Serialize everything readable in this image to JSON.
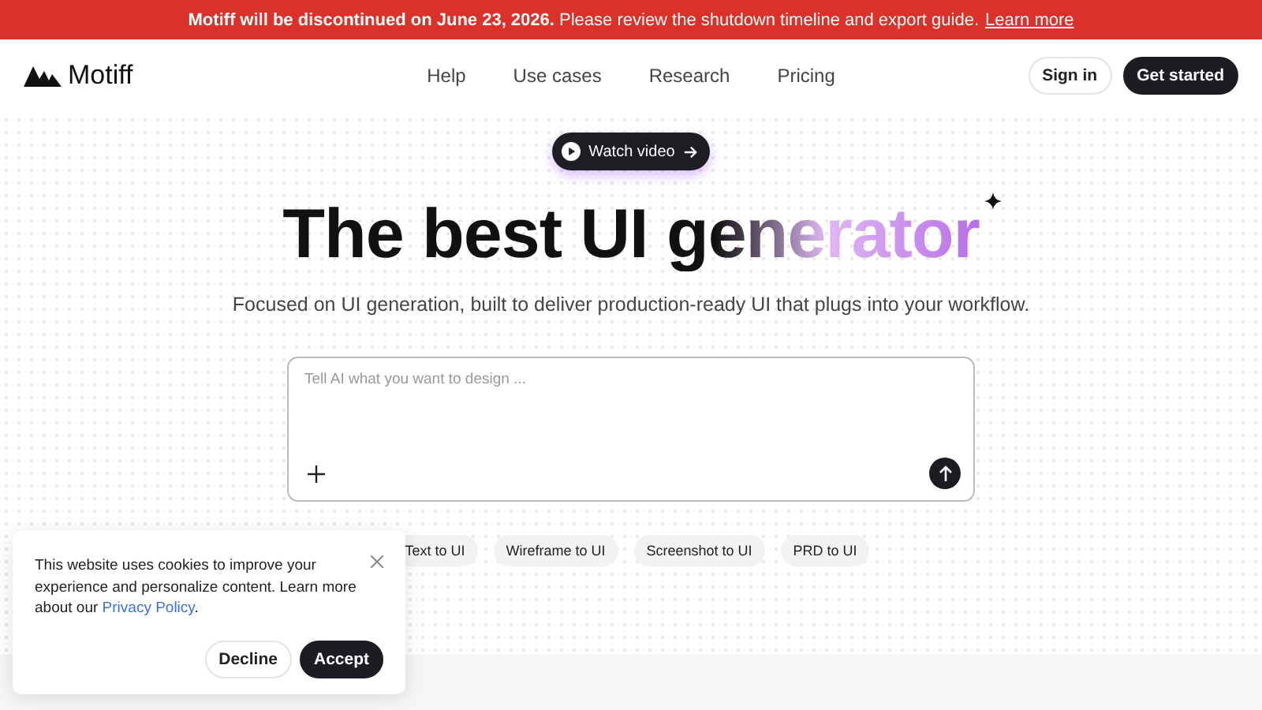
{
  "banner": {
    "text": "**Motiff will be discontinued on June 23, 2026.** Please review the shutdown timeline and export guide.",
    "link": "Learn more"
  },
  "nav": {
    "logo": "Motiff",
    "links": [
      "Help",
      "Use cases",
      "Research",
      "Pricing"
    ],
    "sign_in": "Sign in",
    "get_started": "Get started"
  },
  "hero": {
    "video_button": "Watch video",
    "title": "The best UI generator",
    "subtitle": "Focused on UI generation, built to deliver production-ready UI that plugs into your workflow."
  },
  "prompt": {
    "placeholder": "Tell AI what you want to design ..."
  },
  "chips": [
    "Text to UI",
    "Wireframe to UI",
    "Screenshot to UI",
    "PRD to UI"
  ],
  "cookie": {
    "text": "This website uses cookies to improve your experience and personalize content. Learn more about our",
    "link": "Privacy Policy",
    "after": ".",
    "decline": "Decline",
    "accept": "Accept"
  }
}
